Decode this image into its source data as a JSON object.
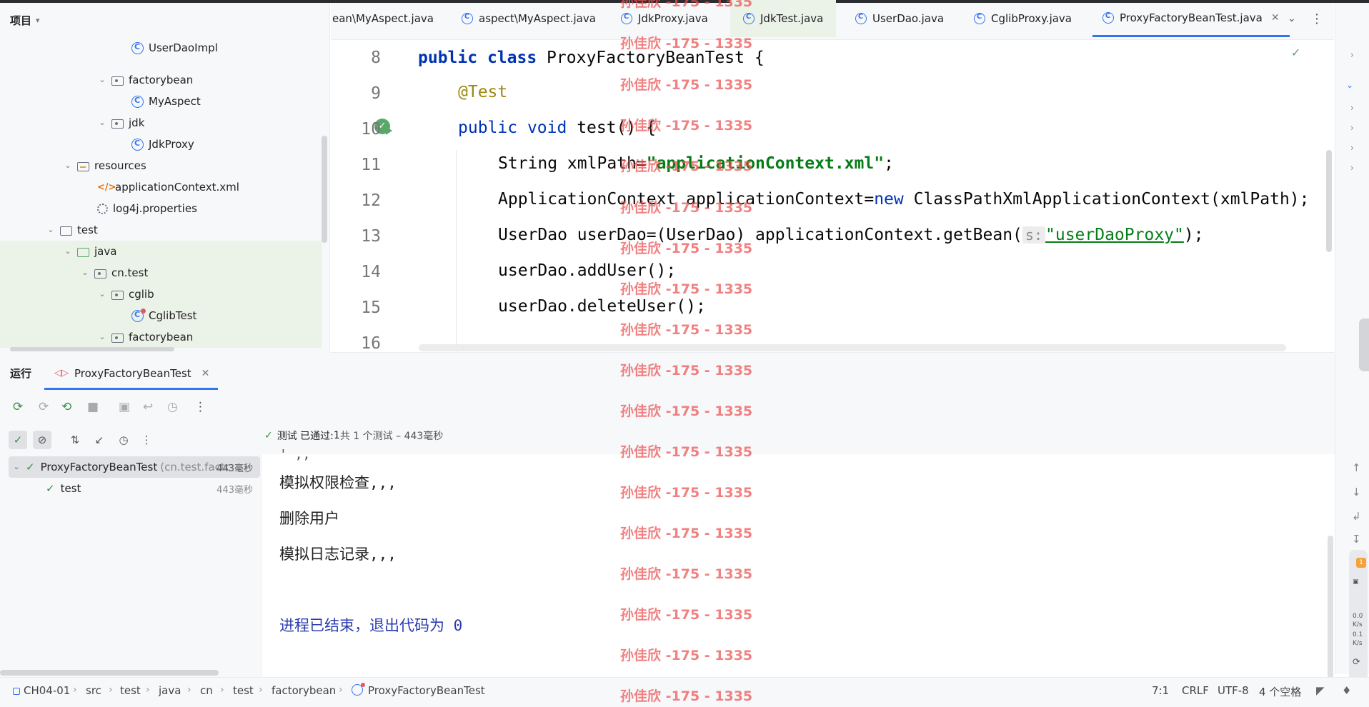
{
  "project": {
    "title": "项目",
    "tree": [
      {
        "label": "UserDaoImpl",
        "icon": "class-icon"
      },
      {
        "label": "factorybean",
        "icon": "package-icon"
      },
      {
        "label": "MyAspect",
        "icon": "class-icon"
      },
      {
        "label": "jdk",
        "icon": "package-icon"
      },
      {
        "label": "JdkProxy",
        "icon": "class-icon"
      },
      {
        "label": "resources",
        "icon": "resources-folder-icon"
      },
      {
        "label": "applicationContext.xml",
        "icon": "xml-file-icon"
      },
      {
        "label": "log4j.properties",
        "icon": "properties-file-icon"
      },
      {
        "label": "test",
        "icon": "folder-icon"
      },
      {
        "label": "java",
        "icon": "folder-icon"
      },
      {
        "label": "cn.test",
        "icon": "package-icon"
      },
      {
        "label": "cglib",
        "icon": "package-icon"
      },
      {
        "label": "CglibTest",
        "icon": "test-class-icon"
      },
      {
        "label": "factorybean",
        "icon": "package-icon"
      }
    ]
  },
  "tabs": [
    {
      "label": "ean\\MyAspect.java"
    },
    {
      "label": "aspect\\MyAspect.java"
    },
    {
      "label": "JdkProxy.java"
    },
    {
      "label": "JdkTest.java"
    },
    {
      "label": "UserDao.java"
    },
    {
      "label": "CglibProxy.java"
    },
    {
      "label": "ProxyFactoryBeanTest.java",
      "active": true
    }
  ],
  "editor": {
    "line_numbers": [
      "8",
      "9",
      "10",
      "11",
      "12",
      "13",
      "14",
      "15",
      "16"
    ],
    "l8": {
      "kw1": "public",
      "kw2": "class",
      "rest": " ProxyFactoryBeanTest {"
    },
    "l9": {
      "ann": "@Test"
    },
    "l10": {
      "kw1": "public",
      "kw2": "void",
      "rest": " test() {"
    },
    "l11": {
      "pre": "String xmlPath=",
      "str": "\"applicationContext.xml\"",
      "post": ";"
    },
    "l12": {
      "pre": "ApplicationContext applicationContext=",
      "kw": "new",
      "post": " ClassPathXmlApplicationContext(xmlPath);"
    },
    "l13": {
      "pre": "UserDao userDao=(UserDao) applicationContext.getBean(",
      "hint": "s:",
      "str": "\"userDaoProxy\"",
      "post": ");"
    },
    "l14": {
      "text": "userDao.addUser();"
    },
    "l15": {
      "text": "userDao.deleteUser();"
    }
  },
  "run": {
    "title": "运行",
    "tab_label": "ProxyFactoryBeanTest",
    "status": {
      "prefix": "测试 已通过: ",
      "count": "1",
      "suffix": "共 1 个测试 – 443毫秒"
    },
    "tree": [
      {
        "name": "ProxyFactoryBeanTest",
        "pkg": "(cn.test.factc",
        "time": "443毫秒"
      },
      {
        "name": "test",
        "time": "443毫秒"
      }
    ],
    "console": {
      "cut_line": "'  ,,",
      "lines": [
        "模拟权限检查,,,",
        "删除用户",
        "模拟日志记录,,,"
      ],
      "exit": "进程已结束，退出代码为 0"
    }
  },
  "status_bar": {
    "crumbs": [
      "CH04-01",
      "src",
      "test",
      "java",
      "cn",
      "test",
      "factorybean",
      "ProxyFactoryBeanTest"
    ],
    "position": "7:1",
    "line_sep": "CRLF",
    "encoding": "UTF-8",
    "indent": "4 个空格"
  },
  "widget": {
    "badge": "1",
    "up": "0.0",
    "up_unit": "K/s",
    "down": "0.1",
    "down_unit": "K/s"
  },
  "watermark": "孙佳欣 -175 - 1335",
  "colors": {
    "accent": "#3574f0",
    "success": "#59a869",
    "keyword": "#0033b3",
    "string": "#067d17",
    "annotation": "#9e880d",
    "watermark": "#eb5050"
  }
}
